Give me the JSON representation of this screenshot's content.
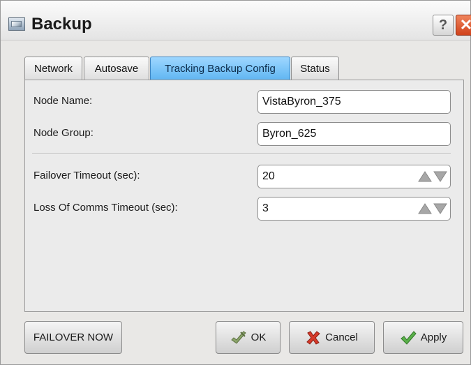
{
  "window": {
    "title": "Backup",
    "help_label": "?",
    "close_label": "✕"
  },
  "tabs": [
    {
      "label": "Network",
      "active": false
    },
    {
      "label": "Autosave",
      "active": false
    },
    {
      "label": "Tracking Backup Config",
      "active": true
    },
    {
      "label": "Status",
      "active": false
    }
  ],
  "form": {
    "node_name_label": "Node Name:",
    "node_name_value": "VistaByron_375",
    "node_group_label": "Node Group:",
    "node_group_value": "Byron_625",
    "failover_timeout_label": "Failover Timeout (sec):",
    "failover_timeout_value": "20",
    "loss_of_comms_label": "Loss Of Comms Timeout (sec):",
    "loss_of_comms_value": "3"
  },
  "buttons": {
    "failover_now": "FAILOVER NOW",
    "ok": "OK",
    "cancel": "Cancel",
    "apply": "Apply"
  },
  "colors": {
    "active_tab": "#6fc0f8",
    "close_button": "#d8512a",
    "panel_background": "#ebebeb"
  },
  "icons": {
    "app": "window-icon",
    "ok": "pencil-check-icon",
    "cancel": "red-x-icon",
    "apply": "green-check-icon",
    "spin_up": "up-triangle-icon",
    "spin_down": "down-triangle-icon"
  }
}
